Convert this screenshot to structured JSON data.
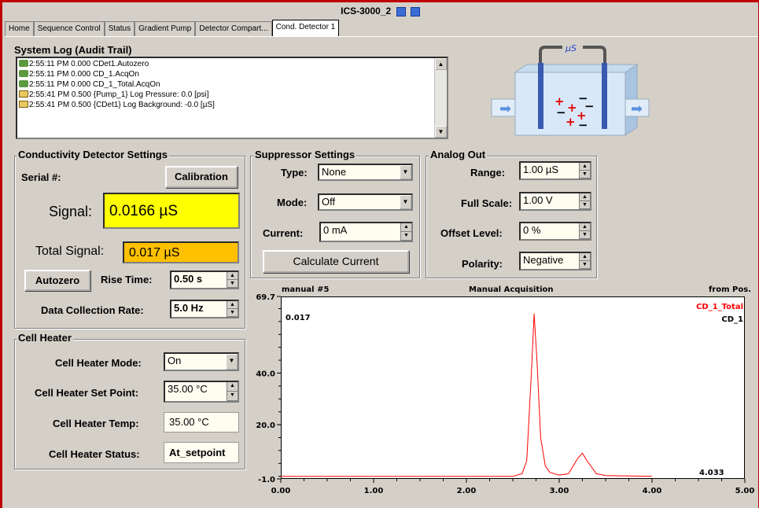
{
  "window": {
    "title": "ICS-3000_2"
  },
  "tabs": [
    "Home",
    "Sequence Control",
    "Status",
    "Gradient Pump",
    "Detector Compart...",
    "Cond. Detector 1"
  ],
  "system_log": {
    "title": "System Log (Audit Trail)",
    "entries": [
      {
        "icon": "run-icon",
        "text": "2:55:11 PM 0.000 CDet1.Autozero"
      },
      {
        "icon": "run-icon",
        "text": "2:55:11 PM 0.000 CD_1.AcqOn"
      },
      {
        "icon": "run-icon",
        "text": "2:55:11 PM 0.000 CD_1_Total.AcqOn"
      },
      {
        "icon": "book-icon",
        "text": "2:55:41 PM 0.500 {Pump_1} Log Pressure: 0.0 [psi]"
      },
      {
        "icon": "book-icon",
        "text": "2:55:41 PM 0.500 {CDet1} Log Background: -0.0 [µS]"
      }
    ]
  },
  "cell_diagram": {
    "label": "µS"
  },
  "conductivity": {
    "title": "Conductivity Detector Settings",
    "serial_label": "Serial #:",
    "calibration_label": "Calibration",
    "signal_label": "Signal:",
    "signal_value": "0.0166 µS",
    "total_signal_label": "Total Signal:",
    "total_signal_value": "0.017 µS",
    "autozero_label": "Autozero",
    "rise_time_label": "Rise Time:",
    "rise_time_value": "0.50 s",
    "dcr_label": "Data Collection Rate:",
    "dcr_value": "5.0 Hz"
  },
  "suppressor": {
    "title": "Suppressor Settings",
    "type_label": "Type:",
    "type_value": "None",
    "mode_label": "Mode:",
    "mode_value": "Off",
    "current_label": "Current:",
    "current_value": "0 mA",
    "calc_label": "Calculate Current"
  },
  "analog": {
    "title": "Analog Out",
    "range_label": "Range:",
    "range_value": "1.00 µS",
    "full_scale_label": "Full Scale:",
    "full_scale_value": "1.00 V",
    "offset_label": "Offset Level:",
    "offset_value": "0 %",
    "polarity_label": "Polarity:",
    "polarity_value": "Negative"
  },
  "heater": {
    "title": "Cell Heater",
    "mode_label": "Cell Heater Mode:",
    "mode_value": "On",
    "setpoint_label": "Cell Heater Set Point:",
    "setpoint_value": "35.00 °C",
    "temp_label": "Cell Heater Temp:",
    "temp_value": "35.00 °C",
    "status_label": "Cell Heater Status:",
    "status_value": "At_setpoint"
  },
  "chart_data": {
    "type": "line",
    "title": "Manual Acquisition",
    "left_header": "manual #5",
    "right_header": "from Pos.",
    "ylim": [
      -1.0,
      69.7
    ],
    "xlim": [
      0.0,
      5.0
    ],
    "yticks": [
      -1.0,
      20.0,
      40.0,
      69.7
    ],
    "ytick_labels": [
      "-1.0",
      "20.0",
      "40.0",
      "69.7"
    ],
    "xticks": [
      0.0,
      1.0,
      2.0,
      3.0,
      4.0,
      5.0
    ],
    "xtick_labels": [
      "0.00",
      "1.00",
      "2.00",
      "3.00",
      "4.00",
      "5.00"
    ],
    "current_value_label": "0.017",
    "current_time_label": "4.033",
    "series": [
      {
        "name": "CD_1_Total",
        "color": "#ff0000",
        "x": [
          0.0,
          2.5,
          2.6,
          2.65,
          2.7,
          2.73,
          2.76,
          2.8,
          2.85,
          2.9,
          3.0,
          3.1,
          3.2,
          3.25,
          3.3,
          3.4,
          3.5,
          4.0
        ],
        "y": [
          0.0,
          0.0,
          1.0,
          6.0,
          40.0,
          63.0,
          45.0,
          15.0,
          4.0,
          1.5,
          0.5,
          1.0,
          7.0,
          9.0,
          6.0,
          1.0,
          0.3,
          0.0
        ]
      },
      {
        "name": "CD_1",
        "color": "#000000",
        "x": [],
        "y": []
      }
    ]
  }
}
